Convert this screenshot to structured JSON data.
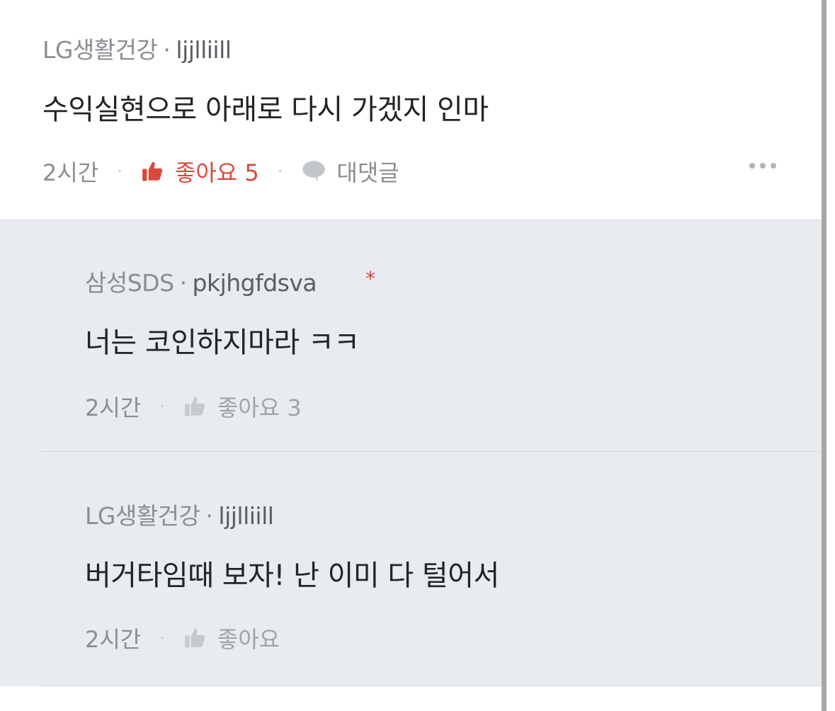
{
  "comment": {
    "company": "LG생활건강",
    "separator": "·",
    "nickname": "ljjlliill",
    "text": "수익실현으로 아래로 다시 가겠지 인마",
    "time": "2시간",
    "like_label": "좋아요 5",
    "reply_label": "대댓글",
    "more_icon": "more-dots-icon"
  },
  "replies": [
    {
      "company": "삼성SDS",
      "separator": "·",
      "nickname": "pkjhgfdsva",
      "marker": "*",
      "text": "너는 코인하지마라 ㅋㅋ",
      "time": "2시간",
      "like_label": "좋아요 3"
    },
    {
      "company": "LG생활건강",
      "separator": "·",
      "nickname": "ljjlliill",
      "text": "버거타임때 보자! 난 이미 다 털어서",
      "time": "2시간",
      "like_label": "좋아요"
    }
  ],
  "colors": {
    "accent_red": "#d9483b",
    "reply_bg": "#e8ebef",
    "text_dark": "#222427",
    "text_muted": "#8a8d91"
  }
}
